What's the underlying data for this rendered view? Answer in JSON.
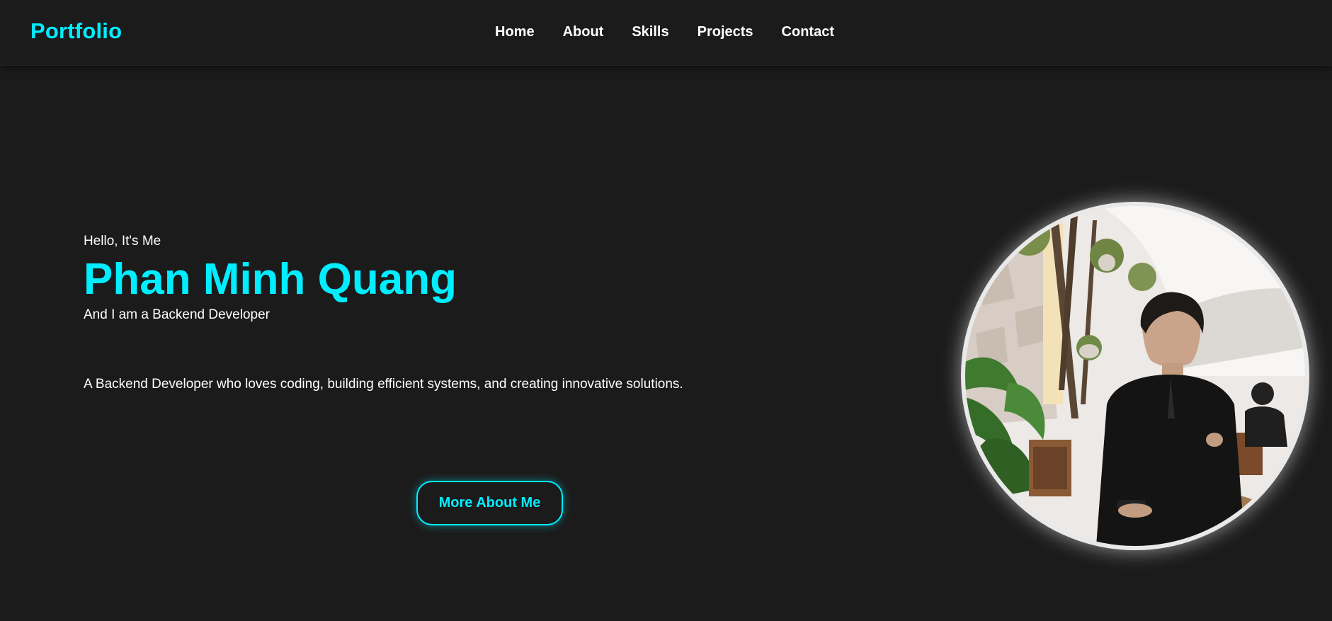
{
  "header": {
    "logo": "Portfolio",
    "nav": [
      "Home",
      "About",
      "Skills",
      "Projects",
      "Contact"
    ]
  },
  "hero": {
    "greeting": "Hello, It's Me",
    "name": "Phan Minh Quang",
    "role": "And I am a Backend Developer",
    "description": "A Backend Developer who loves coding, building efficient systems, and creating innovative solutions.",
    "cta_label": "More About Me"
  },
  "colors": {
    "background": "#1b1b1b",
    "accent": "#00eeff",
    "text": "#ffffff"
  }
}
